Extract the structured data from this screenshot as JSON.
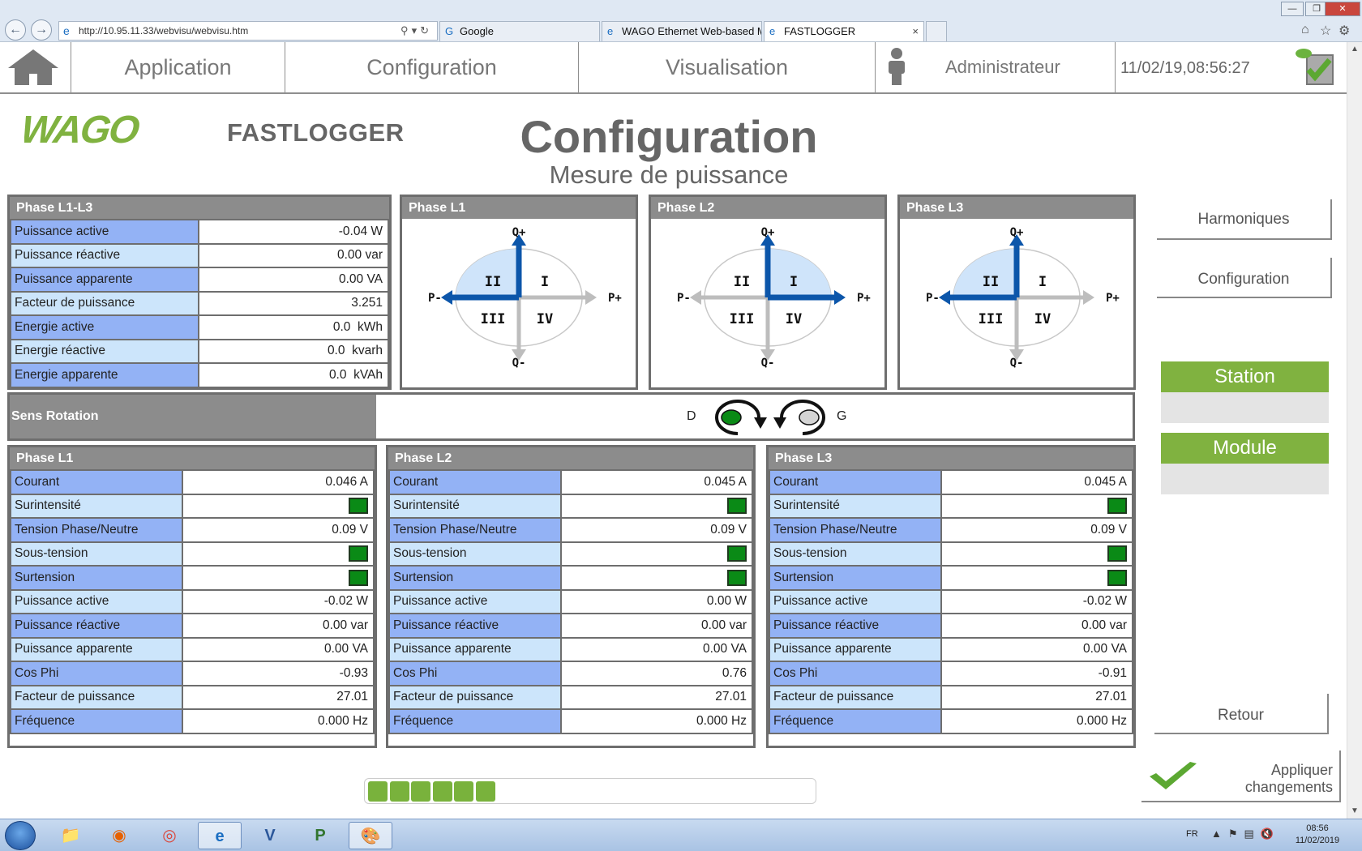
{
  "browser": {
    "url": "http://10.95.11.33/webvisu/webvisu.htm",
    "tabs": [
      {
        "label": "Google",
        "icon": "google-icon"
      },
      {
        "label": "WAGO Ethernet Web-based M...",
        "icon": "ie-icon"
      },
      {
        "label": "FASTLOGGER",
        "icon": "ie-icon",
        "close": "×"
      }
    ]
  },
  "topbar": {
    "application": "Application",
    "configuration": "Configuration",
    "visualisation": "Visualisation",
    "user": "Administrateur",
    "datetime": "11/02/19,08:56:27"
  },
  "header": {
    "brand": "FASTLOGGER",
    "title": "Configuration",
    "subtitle": "Mesure de puissance"
  },
  "summary": {
    "title": "Phase L1-L3",
    "rows": [
      {
        "label": "Puissance active",
        "value": "-0.04 W"
      },
      {
        "label": "Puissance réactive",
        "value": "0.00 var"
      },
      {
        "label": "Puissance apparente",
        "value": "0.00 VA"
      },
      {
        "label": "Facteur de puissance",
        "value": "3.251"
      },
      {
        "label": "Energie active",
        "value": "0.0  kWh"
      },
      {
        "label": "Energie réactive",
        "value": "0.0  kvarh"
      },
      {
        "label": "Energie apparente",
        "value": "0.0  kVAh"
      }
    ]
  },
  "quadrant_labels": {
    "qplus": "Q+",
    "qminus": "Q-",
    "pplus": "P+",
    "pminus": "P-",
    "q1": "I",
    "q2": "II",
    "q3": "III",
    "q4": "IV"
  },
  "quadrants": [
    {
      "title": "Phase L1",
      "highlight": "II",
      "active_arrows": [
        "Q+",
        "P-"
      ]
    },
    {
      "title": "Phase L2",
      "highlight": "I",
      "active_arrows": [
        "Q+",
        "P+"
      ]
    },
    {
      "title": "Phase L3",
      "highlight": "II",
      "active_arrows": [
        "Q+",
        "P-"
      ]
    }
  ],
  "rotation": {
    "label": "Sens Rotation",
    "d": "D",
    "g": "G",
    "direction": "D"
  },
  "phases": [
    {
      "title": "Phase L1",
      "rows": [
        {
          "label": "Courant",
          "value": "0.046 A"
        },
        {
          "label": "Surintensité",
          "status": "ok"
        },
        {
          "label": "Tension Phase/Neutre",
          "value": "0.09 V"
        },
        {
          "label": "Sous-tension",
          "status": "ok"
        },
        {
          "label": "Surtension",
          "status": "ok"
        },
        {
          "label": "Puissance active",
          "value": "-0.02 W"
        },
        {
          "label": "Puissance réactive",
          "value": "0.00 var"
        },
        {
          "label": "Puissance apparente",
          "value": "0.00 VA"
        },
        {
          "label": "Cos Phi",
          "value": "-0.93"
        },
        {
          "label": "Facteur de puissance",
          "value": "27.01"
        },
        {
          "label": "Fréquence",
          "value": "0.000 Hz"
        }
      ]
    },
    {
      "title": "Phase L2",
      "rows": [
        {
          "label": "Courant",
          "value": "0.045 A"
        },
        {
          "label": "Surintensité",
          "status": "ok"
        },
        {
          "label": "Tension Phase/Neutre",
          "value": "0.09 V"
        },
        {
          "label": "Sous-tension",
          "status": "ok"
        },
        {
          "label": "Surtension",
          "status": "ok"
        },
        {
          "label": "Puissance active",
          "value": "0.00 W"
        },
        {
          "label": "Puissance réactive",
          "value": "0.00 var"
        },
        {
          "label": "Puissance apparente",
          "value": "0.00 VA"
        },
        {
          "label": "Cos Phi",
          "value": "0.76"
        },
        {
          "label": "Facteur de puissance",
          "value": "27.01"
        },
        {
          "label": "Fréquence",
          "value": "0.000 Hz"
        }
      ]
    },
    {
      "title": "Phase L3",
      "rows": [
        {
          "label": "Courant",
          "value": "0.045 A"
        },
        {
          "label": "Surintensité",
          "status": "ok"
        },
        {
          "label": "Tension Phase/Neutre",
          "value": "0.09 V"
        },
        {
          "label": "Sous-tension",
          "status": "ok"
        },
        {
          "label": "Surtension",
          "status": "ok"
        },
        {
          "label": "Puissance active",
          "value": "-0.02 W"
        },
        {
          "label": "Puissance réactive",
          "value": "0.00 var"
        },
        {
          "label": "Puissance apparente",
          "value": "0.00 VA"
        },
        {
          "label": "Cos Phi",
          "value": "-0.91"
        },
        {
          "label": "Facteur de puissance",
          "value": "27.01"
        },
        {
          "label": "Fréquence",
          "value": "0.000 Hz"
        }
      ]
    }
  ],
  "side": {
    "harmoniques": "Harmoniques",
    "configuration": "Configuration",
    "station": "Station",
    "module": "Module",
    "retour": "Retour",
    "apply": "Appliquer changements"
  },
  "progress": {
    "segments_filled": 6
  },
  "taskbar": {
    "lang": "FR",
    "time": "08:56",
    "date": "11/02/2019"
  },
  "colors": {
    "label_blue": "#93b2f5",
    "label_light": "#cce5fb",
    "header_grey": "#8c8c8c",
    "ok_green": "#0a8a16",
    "accent_green": "#80b240",
    "arrow_blue": "#0c56aa",
    "quadrant_fill": "#cfe4fa"
  }
}
